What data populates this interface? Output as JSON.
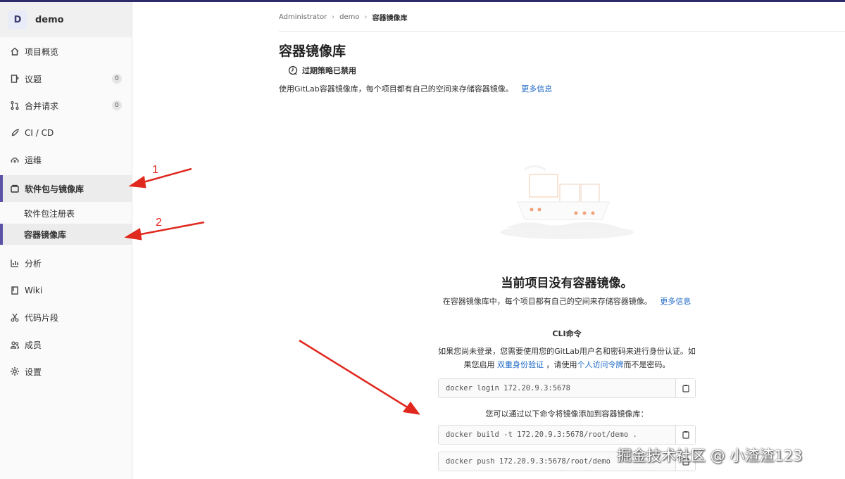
{
  "project": {
    "avatar_letter": "D",
    "name": "demo"
  },
  "nav": {
    "overview": "项目概览",
    "issues": "议题",
    "issues_count": "0",
    "merge_requests": "合并请求",
    "mr_count": "0",
    "cicd": "CI / CD",
    "operations": "运维",
    "packages": "软件包与镜像库",
    "package_registry": "软件包注册表",
    "container_registry": "容器镜像库",
    "analytics": "分析",
    "wiki": "Wiki",
    "snippets": "代码片段",
    "members": "成员",
    "settings": "设置"
  },
  "breadcrumb": {
    "root": "Administrator",
    "project": "demo",
    "current": "容器镜像库"
  },
  "page": {
    "title": "容器镜像库",
    "policy": "过期策略已禁用",
    "intro": "使用GitLab容器镜像库，每个项目都有自己的空间来存储容器镜像。",
    "intro_link": "更多信息"
  },
  "empty": {
    "title": "当前项目没有容器镜像。",
    "desc": "在容器镜像库中，每个项目都有自己的空间来存储容器镜像。",
    "desc_link": "更多信息"
  },
  "cli": {
    "title": "CLI命令",
    "desc_part1": "如果您尚未登录，您需要使用您的GitLab用户名和密码来进行身份认证。如果您启用",
    "desc_link1": "双重身份验证",
    "desc_part2": "，请使用",
    "desc_link2": "个人访问令牌",
    "desc_part3": "而不是密码。",
    "login_cmd": "docker login 172.20.9.3:5678",
    "add_desc": "您可以通过以下命令将镜像添加到容器镜像库：",
    "build_cmd": "docker build -t 172.20.9.3:5678/root/demo .",
    "push_cmd": "docker push 172.20.9.3:5678/root/demo"
  },
  "annotations": {
    "arrow1_label": "1",
    "arrow2_label": "2"
  },
  "watermark": "掘金技术社区 @ 小渣渣123",
  "colors": {
    "accent": "#5b52a8",
    "link": "#1f6ac7",
    "arrow": "#e0281e"
  }
}
